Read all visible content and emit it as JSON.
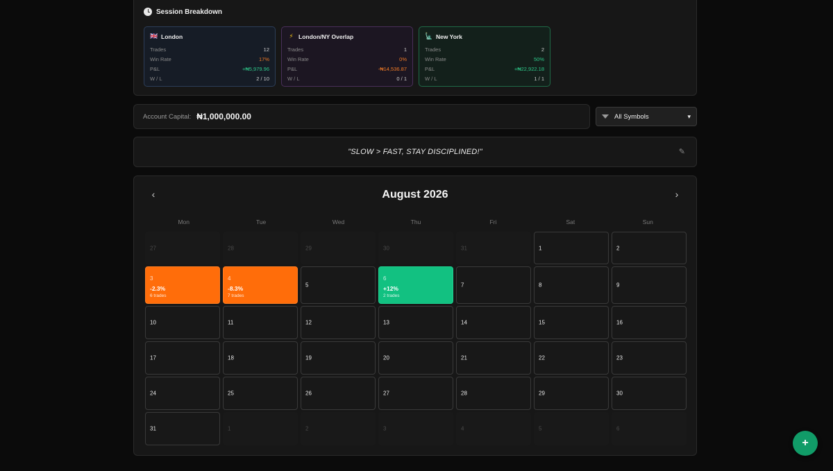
{
  "session_breakdown": {
    "title": "Session Breakdown",
    "icon": "clock-icon",
    "sessions": [
      {
        "name": "London",
        "icon": "uk-flag-icon",
        "trades": "12",
        "win_rate": "17%",
        "pnl": "+₦5,979.96",
        "wl": "2 / 10"
      },
      {
        "name": "London/NY Overlap",
        "icon": "lightning-icon",
        "trades": "1",
        "win_rate": "0%",
        "pnl": "-₦14,536.87",
        "wl": "0 / 1"
      },
      {
        "name": "New York",
        "icon": "statue-of-liberty-icon",
        "trades": "2",
        "win_rate": "50%",
        "pnl": "+₦22,922.18",
        "wl": "1 / 1"
      }
    ],
    "row_labels": {
      "trades": "Trades",
      "win_rate": "Win Rate",
      "pnl": "P&L",
      "wl": "W / L"
    }
  },
  "capital": {
    "label": "Account Capital:",
    "value": "₦1,000,000.00"
  },
  "symbol_filter": {
    "selected": "All Symbols"
  },
  "quote": {
    "text": "\"SLOW > FAST, STAY DISCIPLINED!\""
  },
  "calendar": {
    "title": "August 2026",
    "weekdays": [
      "Mon",
      "Tue",
      "Wed",
      "Thu",
      "Fri",
      "Sat",
      "Sun"
    ],
    "days": [
      {
        "d": "27",
        "out": true
      },
      {
        "d": "28",
        "out": true
      },
      {
        "d": "29",
        "out": true
      },
      {
        "d": "30",
        "out": true
      },
      {
        "d": "31",
        "out": true
      },
      {
        "d": "1"
      },
      {
        "d": "2"
      },
      {
        "d": "3",
        "result": "loss",
        "pct": "-2.3%",
        "trades": "6 trades"
      },
      {
        "d": "4",
        "result": "loss",
        "pct": "-8.3%",
        "trades": "7 trades"
      },
      {
        "d": "5"
      },
      {
        "d": "6",
        "result": "win",
        "pct": "+12%",
        "trades": "2 trades"
      },
      {
        "d": "7"
      },
      {
        "d": "8"
      },
      {
        "d": "9"
      },
      {
        "d": "10"
      },
      {
        "d": "11"
      },
      {
        "d": "12"
      },
      {
        "d": "13"
      },
      {
        "d": "14"
      },
      {
        "d": "15"
      },
      {
        "d": "16"
      },
      {
        "d": "17"
      },
      {
        "d": "18"
      },
      {
        "d": "19"
      },
      {
        "d": "20"
      },
      {
        "d": "21"
      },
      {
        "d": "22"
      },
      {
        "d": "23"
      },
      {
        "d": "24"
      },
      {
        "d": "25"
      },
      {
        "d": "26"
      },
      {
        "d": "27"
      },
      {
        "d": "28"
      },
      {
        "d": "29"
      },
      {
        "d": "30"
      },
      {
        "d": "31"
      },
      {
        "d": "1",
        "out": true
      },
      {
        "d": "2",
        "out": true
      },
      {
        "d": "3",
        "out": true
      },
      {
        "d": "4",
        "out": true
      },
      {
        "d": "5",
        "out": true
      },
      {
        "d": "6",
        "out": true
      }
    ]
  },
  "fab": {
    "label": "+"
  },
  "colors": {
    "loss": "#ff6d0a",
    "win": "#12c181",
    "accent": "#119c68"
  }
}
